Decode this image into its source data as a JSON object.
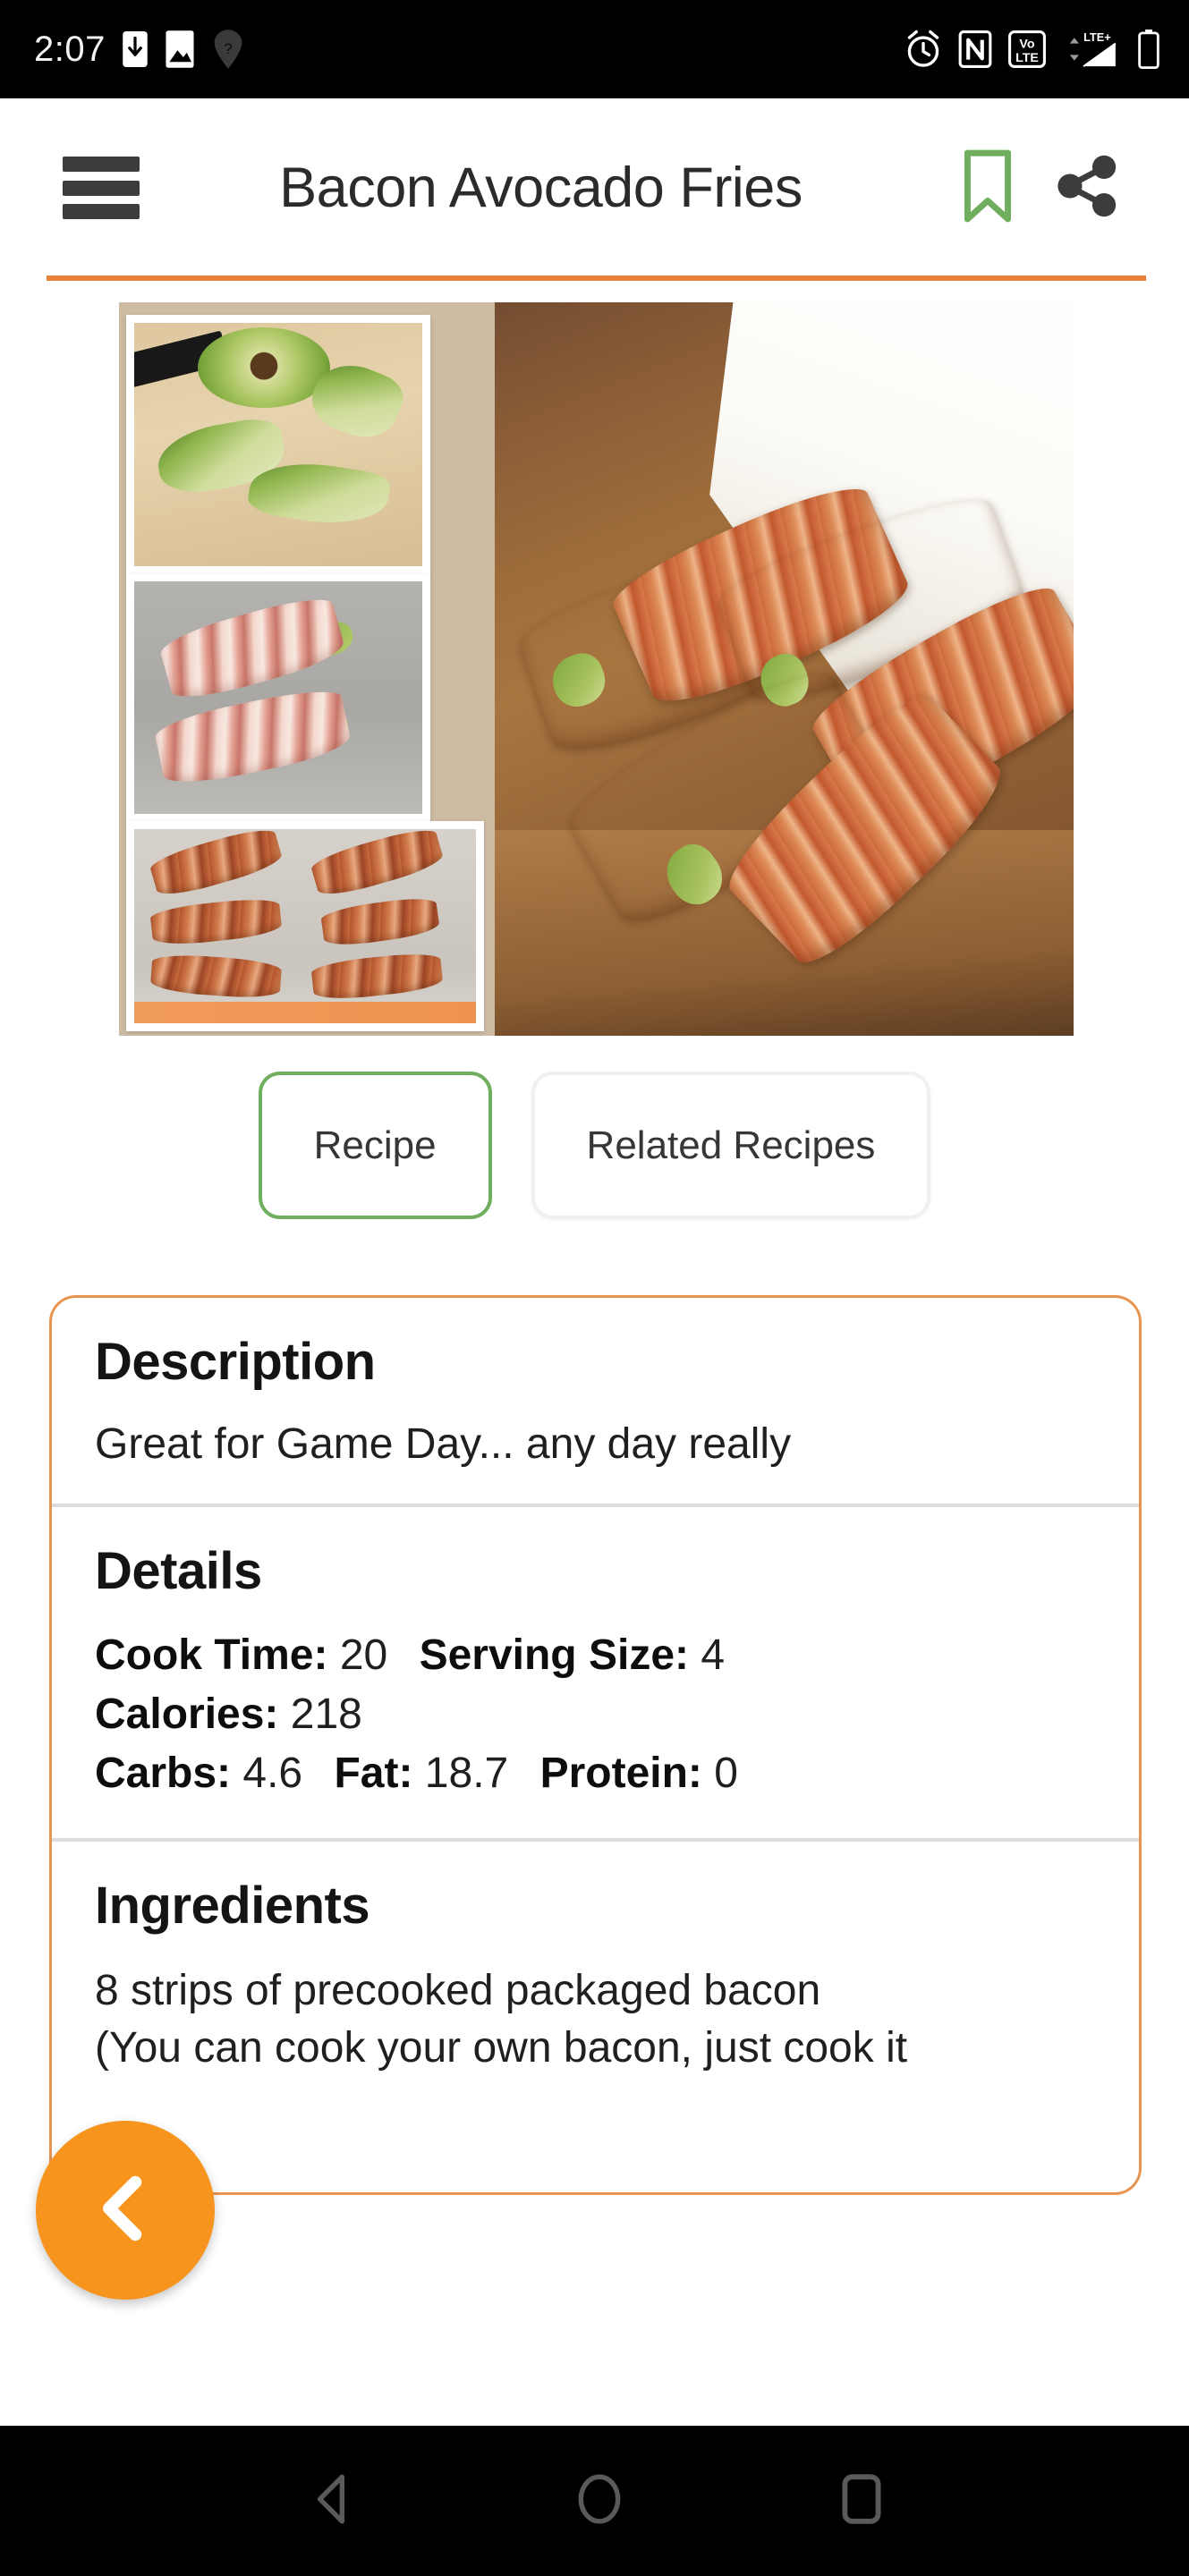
{
  "status_bar": {
    "time": "2:07",
    "left_icons": [
      "download-to-phone-icon",
      "image-icon",
      "unknown-location-icon"
    ],
    "right_icons": [
      "alarm-clock-icon",
      "nfc-icon",
      "volte-icon",
      "lte-plus-signal-icon",
      "battery-icon"
    ],
    "network_label": "LTE+",
    "volte_label_top": "Vo",
    "volte_label_bottom": "LTE",
    "nfc_label": "N",
    "background": "#000000"
  },
  "app_bar": {
    "menu_icon": "hamburger-menu-icon",
    "title": "Bacon Avocado Fries",
    "bookmark_icon": "bookmark-icon",
    "bookmark_color": "#6FAE5F",
    "share_icon": "share-icon",
    "share_color": "#3C3C3C",
    "underline_color": "#E8823A"
  },
  "hero": {
    "alt": "recipe-photo-collage",
    "thumbnails": [
      "sliced-avocado-on-cutting-board",
      "raw-bacon-wrapped-avocado-on-tray",
      "cooked-bacon-avocado-fries-on-tray"
    ],
    "main_photo": "bacon-avocado-fries-in-paper-cone"
  },
  "tabs": [
    {
      "label": "Recipe",
      "active": true,
      "border_color": "#6FAE5F"
    },
    {
      "label": "Related Recipes",
      "active": false,
      "border_color": "#F0F0F0"
    }
  ],
  "card": {
    "border_color": "#E8944F",
    "description": {
      "heading": "Description",
      "text": "Great for Game Day... any day really"
    },
    "details": {
      "heading": "Details",
      "rows": [
        [
          {
            "label": "Cook Time:",
            "value": "20"
          },
          {
            "label": "Serving Size:",
            "value": "4"
          }
        ],
        [
          {
            "label": "Calories:",
            "value": "218"
          }
        ],
        [
          {
            "label": "Carbs:",
            "value": "4.6"
          },
          {
            "label": "Fat:",
            "value": "18.7"
          },
          {
            "label": "Protein:",
            "value": "0"
          }
        ]
      ]
    },
    "ingredients": {
      "heading": "Ingredients",
      "lines": [
        "8 strips of precooked packaged bacon",
        "(You can cook your own bacon, just cook it"
      ]
    }
  },
  "fab": {
    "icon": "chevron-left-icon",
    "color": "#F7941E",
    "icon_color": "#FFFFFF"
  },
  "nav_bar": {
    "items": [
      "back-button",
      "home-button",
      "recents-button"
    ],
    "background": "#000000",
    "icon_color": "#5A5A5A"
  }
}
